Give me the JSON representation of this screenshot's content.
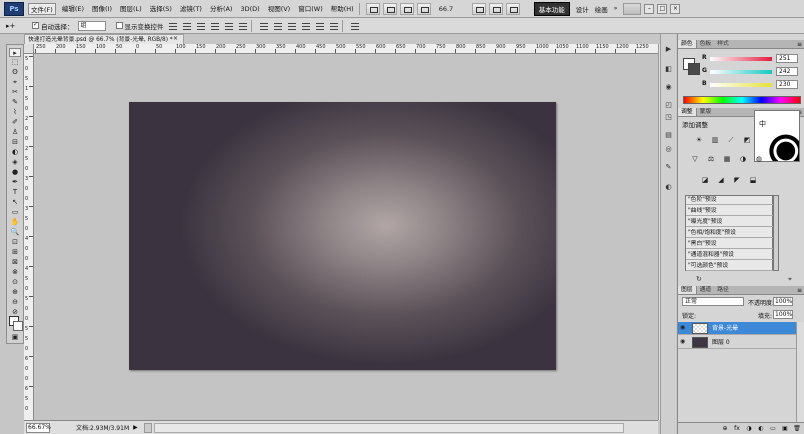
{
  "app": {
    "logo": "Ps",
    "menu": [
      "文件(F)",
      "编辑(E)",
      "图像(I)",
      "图层(L)",
      "选择(S)",
      "滤镜(T)",
      "分析(A)",
      "3D(D)",
      "视图(V)",
      "窗口(W)",
      "帮助(H)"
    ],
    "zoom": "66.7",
    "workspaces": {
      "active": "基本功能",
      "items": [
        "设计",
        "绘画"
      ],
      "more": "»"
    },
    "window_controls": [
      "–",
      "□",
      "×"
    ]
  },
  "options": {
    "tool_symbol": "▸+",
    "auto_select_label": "自动选择：",
    "auto_select_value": "组",
    "show_transform_label": "显示变换控件"
  },
  "document": {
    "tab_title": "快速打造光晕背景.psd @ 66.7% (背景-光晕, RGB/8) *",
    "close": "×",
    "ruler_h": [
      "250",
      "200",
      "150",
      "100",
      "50",
      "0",
      "50",
      "100",
      "150",
      "200",
      "250",
      "300",
      "350",
      "400",
      "450",
      "500",
      "550",
      "600",
      "650",
      "700",
      "750",
      "800",
      "850",
      "900",
      "950",
      "1000",
      "1050",
      "1100",
      "1150",
      "1200",
      "1250",
      "1300"
    ],
    "ruler_v": [
      "5",
      "0",
      "5",
      "1",
      "5",
      "0",
      "2",
      "0",
      "0",
      "2",
      "5",
      "0",
      "3",
      "0",
      "0",
      "3",
      "5",
      "0",
      "4",
      "0",
      "0",
      "4",
      "5",
      "0",
      "5",
      "0",
      "0",
      "5",
      "5",
      "0",
      "6",
      "0",
      "0",
      "6",
      "5",
      "0"
    ]
  },
  "toolbox": {
    "tools": [
      "▸",
      "⬚",
      "ʘ",
      "⌖",
      "✂",
      "✎",
      "⌇",
      "✐",
      "♙",
      "⊟",
      "◐",
      "◈",
      "●",
      "✒",
      "T",
      "↖",
      "▭",
      "✋",
      "🔍",
      "⊡",
      "⊞",
      "⊠",
      "⊗",
      "⊙",
      "⊕",
      "⊖",
      "⊘"
    ],
    "bottom": [
      "▣"
    ]
  },
  "status": {
    "zoom": "66.67%",
    "doc_info": "文档:2.93M/3.91M",
    "arrow": "▶"
  },
  "icon_column": [
    "▶",
    "◧",
    "◉",
    "◰",
    "◳",
    "▤",
    "◎",
    "✎",
    "◐"
  ],
  "color_panel": {
    "tabs": [
      "颜色",
      "色板",
      "样式"
    ],
    "menu": "≡",
    "r_label": "R",
    "g_label": "G",
    "b_label": "B",
    "r": "251",
    "g": "242",
    "b": "230",
    "r_color": "#e21d3e",
    "g_color": "#16c8c0",
    "b_color": "#e6e03a"
  },
  "adjustments": {
    "tabs": [
      "调整",
      "蒙版"
    ],
    "menu": "≡",
    "title": "添加调整",
    "icons_row1": [
      "☀",
      "▥",
      "⟋",
      "◩"
    ],
    "icons_row2": [
      "▽",
      "⚖",
      "▦",
      "◑",
      "◍"
    ],
    "icons_row3": [
      "◪",
      "◢",
      "◤",
      "⬓"
    ],
    "presets": [
      "\"色阶\"预设",
      "\"曲线\"预设",
      "\"曝光度\"预设",
      "\"色相/饱和度\"预设",
      "\"黑白\"预设",
      "\"通道混和器\"预设",
      "\"可选颜色\"预设"
    ],
    "thumb_text": "中",
    "footer_left": "↻",
    "footer_right": "⌖"
  },
  "layers": {
    "tabs": [
      "图层",
      "通道",
      "路径"
    ],
    "menu": "≡",
    "blend_mode": "正常",
    "opacity_label": "不透明度:",
    "opacity": "100%",
    "lock_label": "锁定:",
    "fill_label": "填充:",
    "fill": "100%",
    "items": [
      {
        "name": "背景-光晕",
        "selected": true
      },
      {
        "name": "图层 0",
        "selected": false
      }
    ],
    "eye": "◉",
    "footer_icons": [
      "⊕",
      "fx",
      "◑",
      "◐",
      "▭",
      "▣",
      "🗑"
    ]
  }
}
